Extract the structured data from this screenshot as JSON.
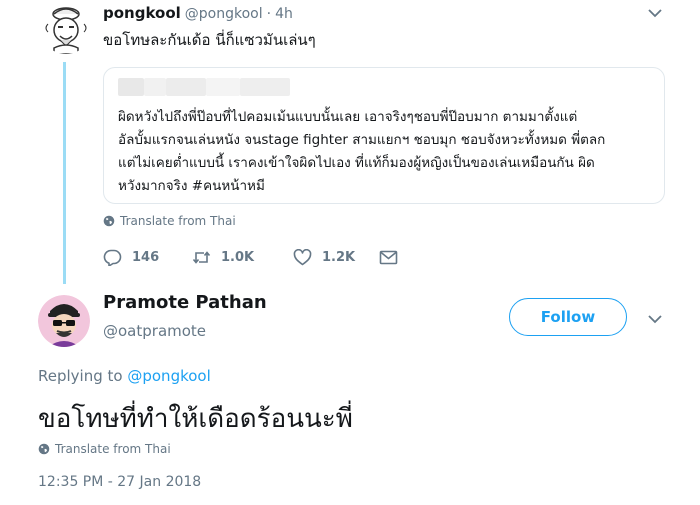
{
  "colors": {
    "accent": "#1da1f2",
    "muted_text": "#657786",
    "primary_text": "#14171a",
    "thread_line": "#9bdcf5",
    "border": "#e1e8ed"
  },
  "reply_tweet": {
    "avatar_icon": "cartoon-avatar-icon",
    "name": "pongkool",
    "handle": "@pongkool",
    "separator": "·",
    "time": "4h",
    "text": "ขอโทษละกันเด้อ นี่ก็แซวมันเล่นๆ",
    "quoted_tweet": {
      "lines": [
        "ผิดหวังไปถึงพี่ป๊อบที่ไปคอมเม้นแบบนั้นเลย เอาจริงๆชอบพี่ป๊อบมาก ตามมาตั้งแต่",
        "อัลบั้มแรกจนเล่นหนัง จนstage fighter สามแยกฯ ชอบมุก ชอบจังหวะทั้งหมด พี่ตลก",
        "แต่ไม่เคยต่ำแบบนี้ เราคงเข้าใจผิดไปเอง ที่แท้ก็มองผู้หญิงเป็นของเล่นเหมือนกัน ผิด",
        "หวังมากจริง #คนหน้าหมี"
      ]
    },
    "translate_label": "Translate from Thai",
    "actions": {
      "reply_count": "146",
      "retweet_count": "1.0K",
      "like_count": "1.2K"
    }
  },
  "main_tweet": {
    "avatar_icon": "cartoon-avatar-icon",
    "name": "Pramote Pathan",
    "handle": "@oatpramote",
    "follow_label": "Follow",
    "replying_prefix": "Replying to",
    "replying_to": "@pongkool",
    "text": "ขอโทษที่ทำให้เดือดร้อนนะพี่",
    "translate_label": "Translate from Thai",
    "timestamp": "12:35 PM - 27 Jan 2018"
  }
}
